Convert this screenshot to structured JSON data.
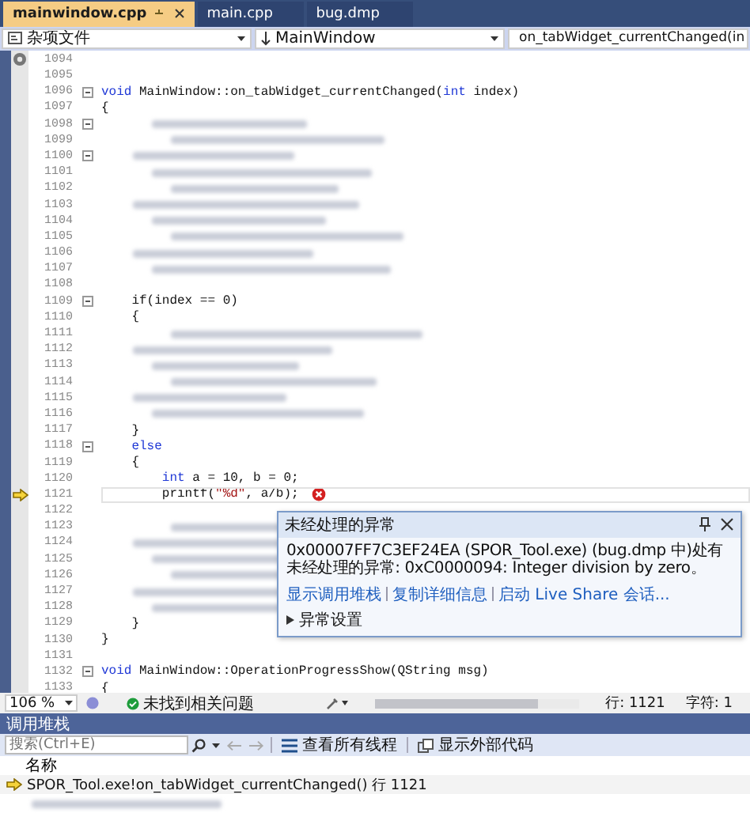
{
  "tabs": [
    {
      "label": "mainwindow.cpp",
      "selected": true
    },
    {
      "label": "main.cpp",
      "selected": false
    },
    {
      "label": "bug.dmp",
      "selected": false
    }
  ],
  "nav": {
    "project": "杂项文件",
    "class": "MainWindow",
    "member": "on_tabWidget_currentChanged(in"
  },
  "lines": [
    {
      "number": "1094"
    },
    {
      "number": "1095"
    },
    {
      "number": "1096",
      "collapsible": true,
      "tokens": [
        {
          "t": "void",
          "kind": "keyword"
        },
        {
          "t": " MainWindow::on_tabWidget_currentChanged(",
          "kind": "plain"
        },
        {
          "t": "int",
          "kind": "keyword"
        },
        {
          "t": " index)",
          "kind": "plain"
        }
      ]
    },
    {
      "number": "1097",
      "tokens": [
        {
          "t": "{",
          "kind": "plain"
        }
      ]
    },
    {
      "number": "1098",
      "collapsible": true,
      "redacted": true
    },
    {
      "number": "1099",
      "redacted": true
    },
    {
      "number": "1100",
      "collapsible": true,
      "redacted": true
    },
    {
      "number": "1101",
      "redacted": true
    },
    {
      "number": "1102",
      "redacted": true
    },
    {
      "number": "1103",
      "redacted": true
    },
    {
      "number": "1104",
      "redacted": true
    },
    {
      "number": "1105",
      "redacted": true
    },
    {
      "number": "1106",
      "redacted": true
    },
    {
      "number": "1107",
      "redacted": true
    },
    {
      "number": "1108"
    },
    {
      "number": "1109",
      "collapsible": true,
      "tokens": [
        {
          "t": "    if(index == 0)",
          "kind": "plain"
        }
      ]
    },
    {
      "number": "1110",
      "tokens": [
        {
          "t": "    {",
          "kind": "plain"
        }
      ]
    },
    {
      "number": "1111",
      "redacted": true
    },
    {
      "number": "1112",
      "redacted": true
    },
    {
      "number": "1113",
      "redacted": true
    },
    {
      "number": "1114",
      "redacted": true
    },
    {
      "number": "1115",
      "redacted": true
    },
    {
      "number": "1116",
      "redacted": true
    },
    {
      "number": "1117",
      "tokens": [
        {
          "t": "    }",
          "kind": "plain"
        }
      ]
    },
    {
      "number": "1118",
      "collapsible": true,
      "tokens": [
        {
          "t": "    else",
          "kind": "keyword"
        }
      ]
    },
    {
      "number": "1119",
      "tokens": [
        {
          "t": "    {",
          "kind": "plain"
        }
      ]
    },
    {
      "number": "1120",
      "tokens": [
        {
          "t": "        int",
          "kind": "keyword"
        },
        {
          "t": " a = 10, b = 0;",
          "kind": "plain"
        }
      ]
    },
    {
      "number": "1121",
      "current": true,
      "error": true,
      "tokens": [
        {
          "t": "        printf(",
          "kind": "plain"
        },
        {
          "t": "\"%d\"",
          "kind": "string"
        },
        {
          "t": ", a/b);",
          "kind": "plain"
        }
      ]
    },
    {
      "number": "1122"
    },
    {
      "number": "1123",
      "redacted": true
    },
    {
      "number": "1124",
      "redacted": true
    },
    {
      "number": "1125",
      "redacted": true
    },
    {
      "number": "1126",
      "redacted": true
    },
    {
      "number": "1127",
      "redacted": true
    },
    {
      "number": "1128",
      "redacted": true
    },
    {
      "number": "1129",
      "tokens": [
        {
          "t": "    }",
          "kind": "plain"
        }
      ]
    },
    {
      "number": "1130",
      "tokens": [
        {
          "t": "}",
          "kind": "plain"
        }
      ]
    },
    {
      "number": "1131"
    },
    {
      "number": "1132",
      "collapsible": true,
      "tokens": [
        {
          "t": "void",
          "kind": "keyword"
        },
        {
          "t": " MainWindow::OperationProgressShow(QString msg)",
          "kind": "plain"
        }
      ]
    },
    {
      "number": "1133",
      "tokens": [
        {
          "t": "{",
          "kind": "plain"
        }
      ]
    }
  ],
  "exception_popup": {
    "title": "未经处理的异常",
    "message": "0x00007FF7C3EF24EA (SPOR_Tool.exe) (bug.dmp 中)处有未经处理的异常: 0xC0000094: Integer division by zero。",
    "links": [
      "显示调用堆栈",
      "复制详细信息",
      "启动 Live Share 会话..."
    ],
    "settings": {
      "label": "异常设置",
      "expanded": false
    }
  },
  "status_bar": {
    "zoom": "106 %",
    "issues": "未找到相关问题",
    "line": "行: 1121",
    "char": "字符: 1"
  },
  "call_stack": {
    "title": "调用堆栈",
    "search": {
      "placeholder": "搜索(Ctrl+E)"
    },
    "buttons": [
      "查看所有线程",
      "显示外部代码"
    ],
    "column": "名称",
    "rows": [
      {
        "name": "SPOR_Tool.exe!on_tabWidget_currentChanged() 行 1121",
        "current": true
      }
    ]
  }
}
